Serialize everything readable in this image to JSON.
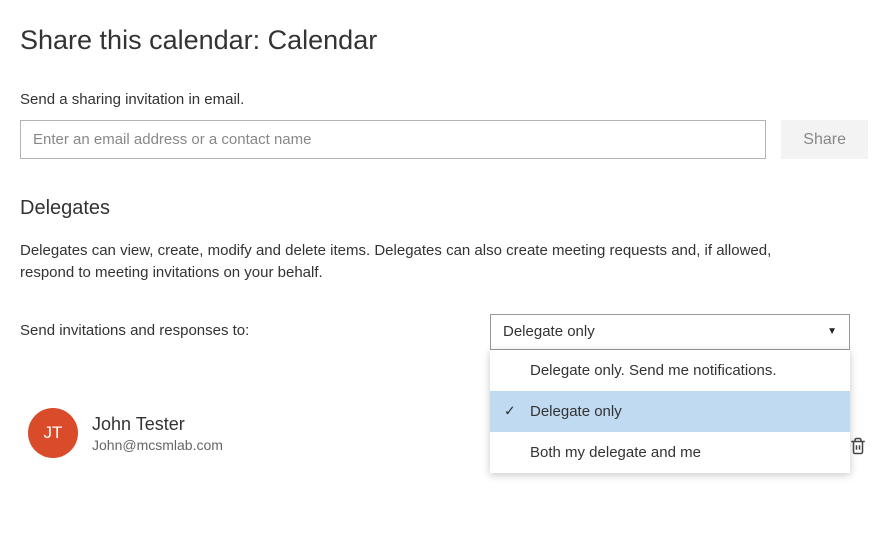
{
  "page": {
    "title": "Share this calendar: Calendar",
    "subtitle": "Send a sharing invitation in email."
  },
  "share": {
    "placeholder": "Enter an email address or a contact name",
    "button_label": "Share"
  },
  "delegates": {
    "title": "Delegates",
    "description": "Delegates can view, create, modify and delete items. Delegates can also create meeting requests and, if allowed, respond to meeting invitations on your behalf.",
    "invitations_label": "Send invitations and responses to:",
    "dropdown_value": "Delegate only",
    "options": [
      "Delegate only. Send me notifications.",
      "Delegate only",
      "Both my delegate and me"
    ]
  },
  "user": {
    "initials": "JT",
    "name": "John Tester",
    "email": "John@mcsmlab.com"
  }
}
